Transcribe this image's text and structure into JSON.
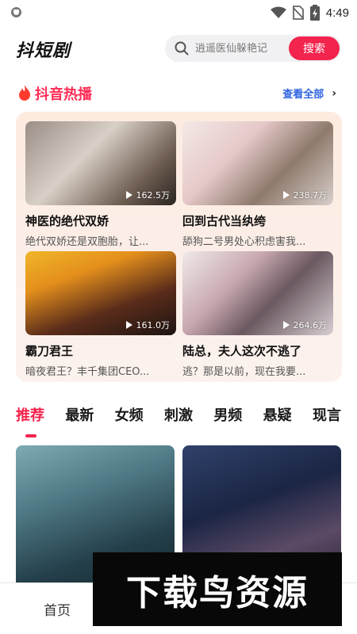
{
  "status_bar": {
    "time": "4:49"
  },
  "header": {
    "app_title": "抖短剧",
    "search_placeholder": "逍遥医仙躲艳记",
    "search_button": "搜索"
  },
  "hot": {
    "title": "抖音热播",
    "see_all": "查看全部",
    "items": [
      {
        "title": "神医的绝代双娇",
        "desc": "绝代双娇还是双胞胎，让...",
        "plays": "162.5万"
      },
      {
        "title": "回到古代当纨绔",
        "desc": "舔狗二号男处心积虑害我...",
        "plays": "238.7万"
      },
      {
        "title": "霸刀君王",
        "desc": "暗夜君王？丰千集团CEO...",
        "plays": "161.0万"
      },
      {
        "title": "陆总，夫人这次不逃了",
        "desc": "逃？那是以前，现在我要...",
        "plays": "264.6万"
      }
    ]
  },
  "tabs": [
    "推荐",
    "最新",
    "女频",
    "刺激",
    "男频",
    "悬疑",
    "现言"
  ],
  "active_tab": "推荐",
  "bottom_nav": {
    "home": "首页"
  },
  "watermark": "下载鸟资源",
  "colors": {
    "accent": "#f3244d",
    "link": "#2f63e0",
    "hot_title": "#ff2d55"
  }
}
